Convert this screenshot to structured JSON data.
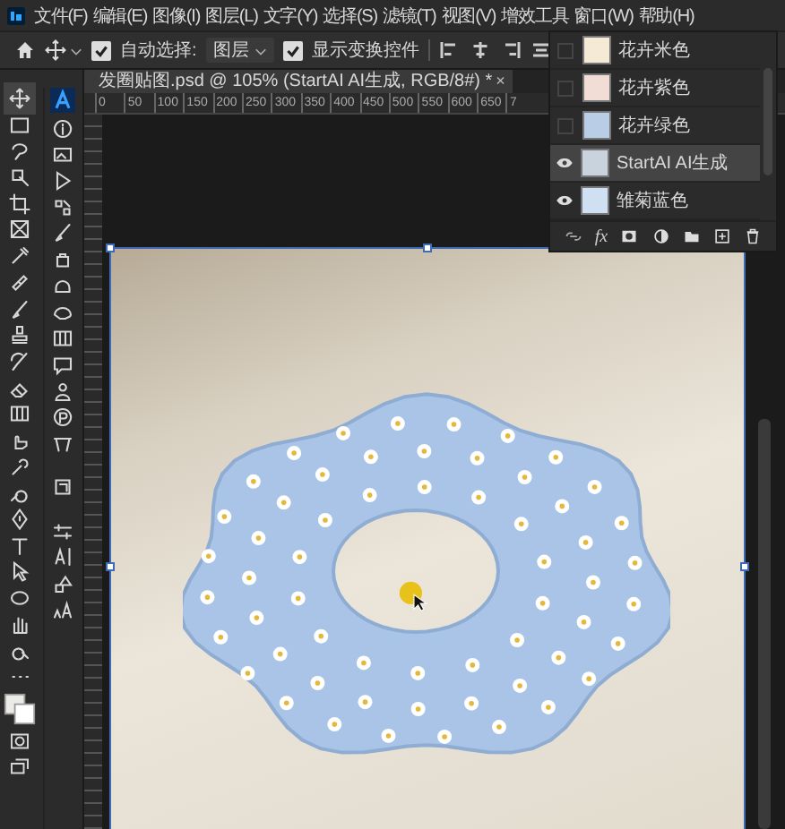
{
  "menu": {
    "items": [
      "文件(F)",
      "编辑(E)",
      "图像(I)",
      "图层(L)",
      "文字(Y)",
      "选择(S)",
      "滤镜(T)",
      "视图(V)",
      "增效工具",
      "窗口(W)",
      "帮助(H)"
    ]
  },
  "options_bar": {
    "auto_select": {
      "label": "自动选择:",
      "checked": true
    },
    "auto_select_target": "图层",
    "show_transform": {
      "label": "显示变换控件",
      "checked": true
    }
  },
  "document_tab": {
    "title": "发圈贴图.psd @ 105% (StartAI AI生成, RGB/8#) *",
    "close": "×"
  },
  "ruler": {
    "labels": [
      "0",
      "50",
      "100",
      "150",
      "200",
      "250",
      "300",
      "350",
      "400",
      "450",
      "500",
      "550",
      "600",
      "650",
      "7"
    ]
  },
  "layers": {
    "rows": [
      {
        "name": "花卉米色",
        "visible": false,
        "selected": false,
        "color": "#f4ead6"
      },
      {
        "name": "花卉紫色",
        "visible": false,
        "selected": false,
        "color": "#f1dcd6"
      },
      {
        "name": "花卉绿色",
        "visible": false,
        "selected": false,
        "color": "#b9cde6"
      },
      {
        "name": "StartAI AI生成",
        "visible": true,
        "selected": true,
        "color": "#c9d3de"
      },
      {
        "name": "雏菊蓝色",
        "visible": true,
        "selected": false,
        "color": "#cfe0f3"
      }
    ],
    "fx_label": "fx"
  }
}
